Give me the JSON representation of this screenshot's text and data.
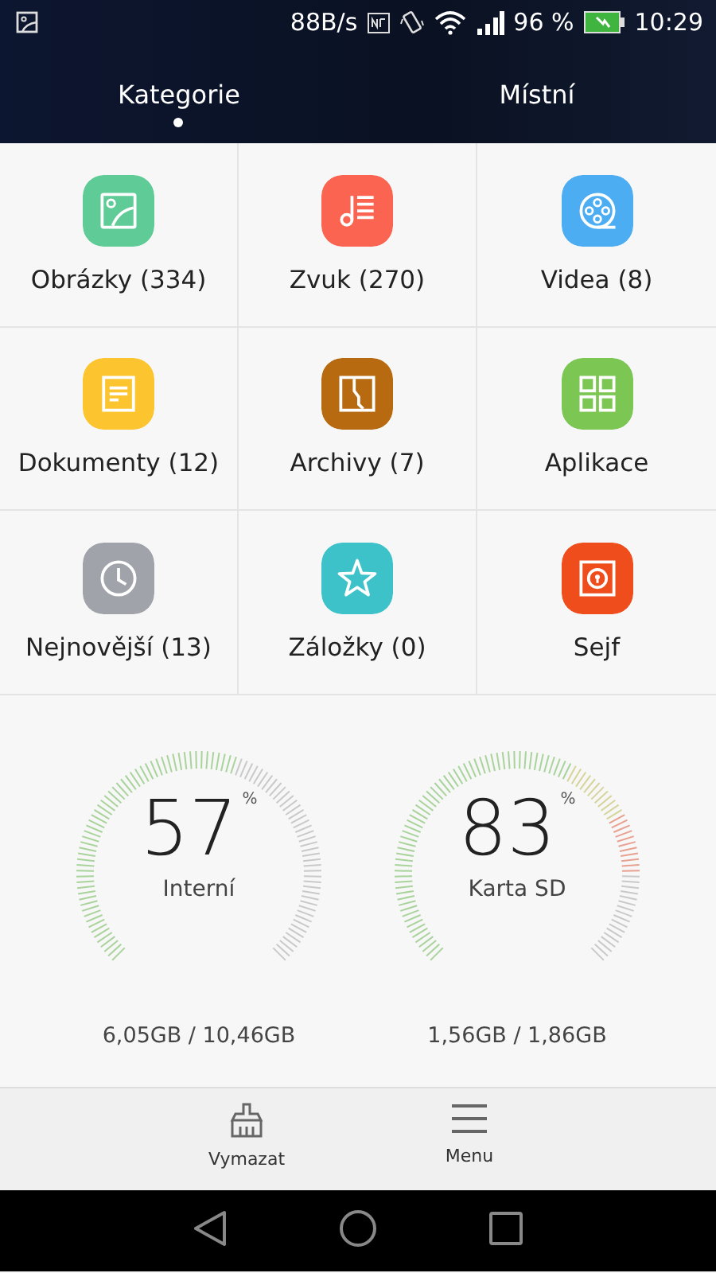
{
  "status_bar": {
    "speed": "88B/s",
    "battery": "96 %",
    "time": "10:29"
  },
  "tabs": [
    {
      "label": "Kategorie",
      "selected": true
    },
    {
      "label": "Místní",
      "selected": false
    }
  ],
  "categories": [
    {
      "label": "Obrázky (334)",
      "kind": "image",
      "color": "#5fcb97"
    },
    {
      "label": "Zvuk (270)",
      "kind": "music",
      "color": "#fb6450"
    },
    {
      "label": "Videa (8)",
      "kind": "video",
      "color": "#4dadf3"
    },
    {
      "label": "Dokumenty (12)",
      "kind": "document",
      "color": "#fcc52f"
    },
    {
      "label": "Archivy (7)",
      "kind": "archive",
      "color": "#b76a10"
    },
    {
      "label": "Aplikace",
      "kind": "apps",
      "color": "#7cc653"
    },
    {
      "label": "Nejnovější (13)",
      "kind": "recent",
      "color": "#a0a3aa"
    },
    {
      "label": "Záložky (0)",
      "kind": "bookmark",
      "color": "#3ec2c9"
    },
    {
      "label": "Sejf",
      "kind": "safe",
      "color": "#f04d1d"
    }
  ],
  "storage": [
    {
      "percent": "57",
      "unit": "%",
      "name": "Interní",
      "usage": "6,05GB / 10,46GB"
    },
    {
      "percent": "83",
      "unit": "%",
      "name": "Karta SD",
      "usage": "1,56GB / 1,86GB"
    }
  ],
  "bottom_bar": [
    {
      "label": "Vymazat",
      "kind": "clean"
    },
    {
      "label": "Menu",
      "kind": "menu"
    }
  ]
}
